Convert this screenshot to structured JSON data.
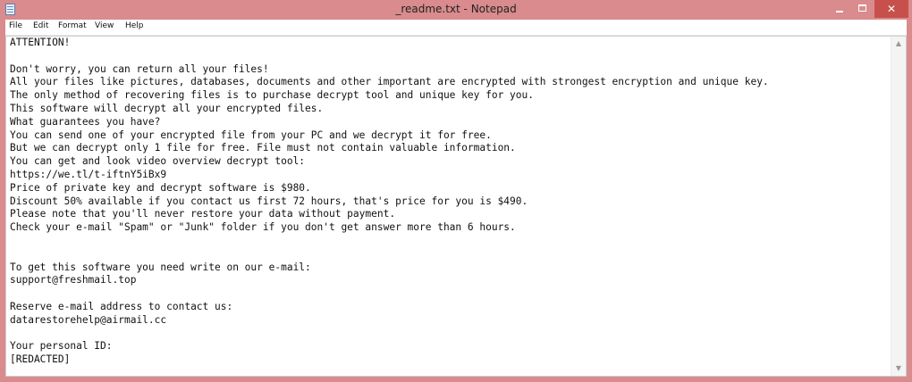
{
  "window": {
    "title": "_readme.txt - Notepad",
    "controls": {
      "minimize": "–",
      "maximize": "□",
      "close": "✕"
    },
    "colors": {
      "frame": "#d98b8d",
      "close_button": "#c7504c"
    }
  },
  "menu": {
    "items": [
      {
        "label": "File"
      },
      {
        "label": "Edit"
      },
      {
        "label": "Format"
      },
      {
        "label": "View"
      },
      {
        "label": "Help"
      }
    ]
  },
  "document": {
    "lines": [
      "ATTENTION!",
      "",
      "Don't worry, you can return all your files!",
      "All your files like pictures, databases, documents and other important are encrypted with strongest encryption and unique key.",
      "The only method of recovering files is to purchase decrypt tool and unique key for you.",
      "This software will decrypt all your encrypted files.",
      "What guarantees you have?",
      "You can send one of your encrypted file from your PC and we decrypt it for free.",
      "But we can decrypt only 1 file for free. File must not contain valuable information.",
      "You can get and look video overview decrypt tool:",
      "https://we.tl/t-iftnY5iBx9",
      "Price of private key and decrypt software is $980.",
      "Discount 50% available if you contact us first 72 hours, that's price for you is $490.",
      "Please note that you'll never restore your data without payment.",
      "Check your e-mail \"Spam\" or \"Junk\" folder if you don't get answer more than 6 hours.",
      "",
      "",
      "To get this software you need write on our e-mail:",
      "support@freshmail.top",
      "",
      "Reserve e-mail address to contact us:",
      "datarestorehelp@airmail.cc",
      "",
      "Your personal ID:",
      "[REDACTED]"
    ]
  },
  "scrollbar": {
    "up_arrow": "▲",
    "down_arrow": "▼"
  }
}
